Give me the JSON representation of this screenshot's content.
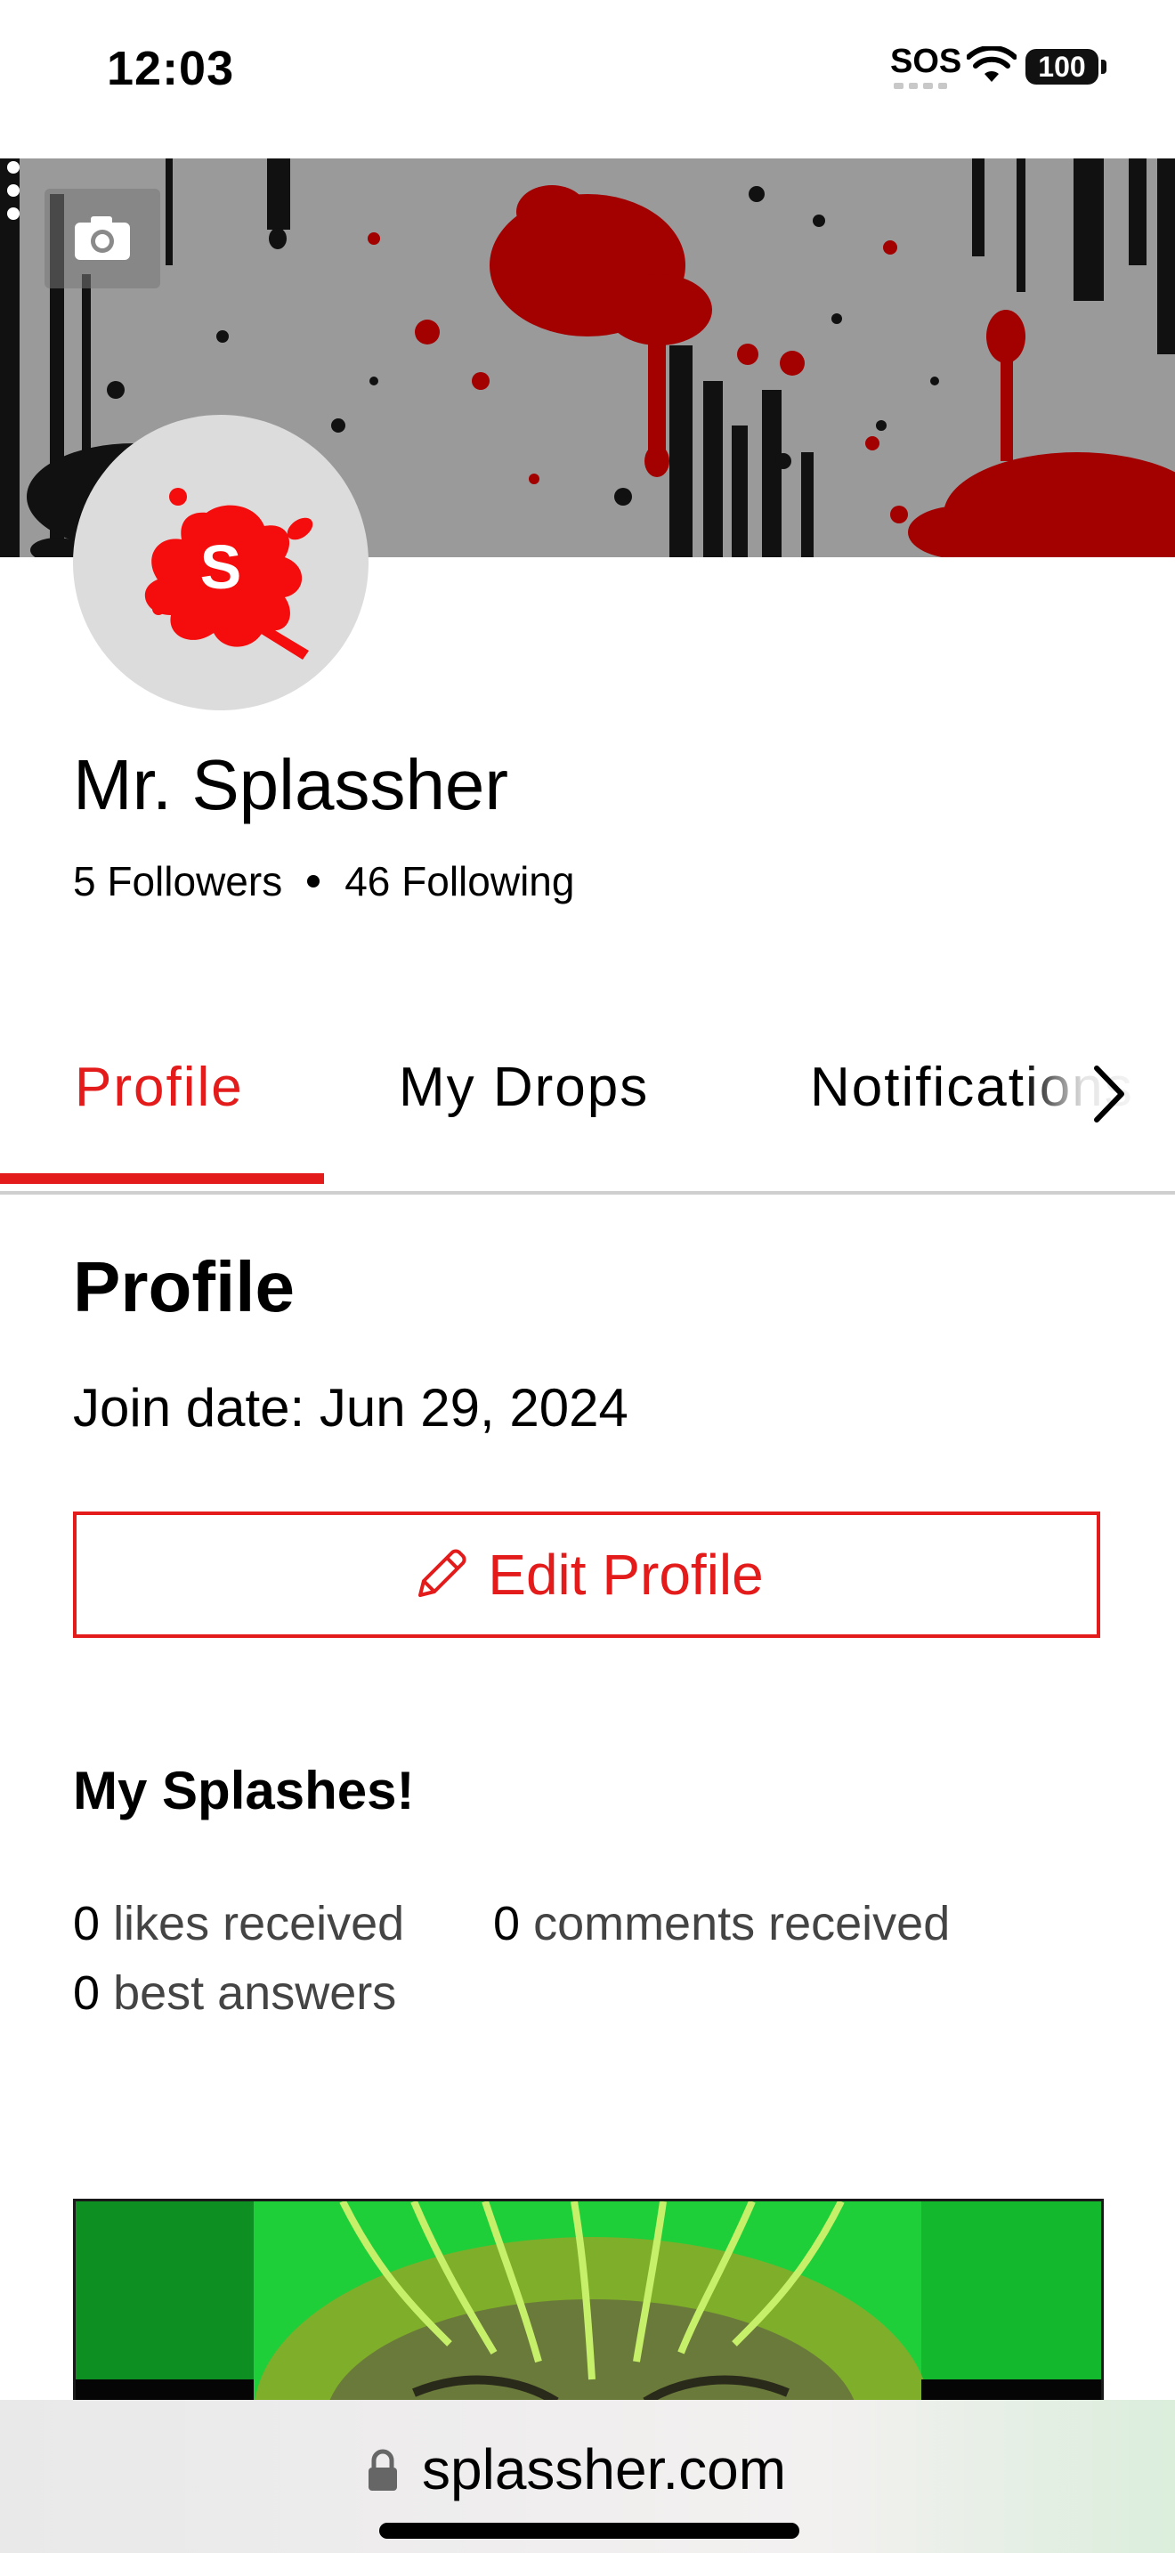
{
  "status_bar": {
    "time": "12:03",
    "sos": "SOS",
    "battery": "100"
  },
  "profile": {
    "name": "Mr. Splassher",
    "followers": "5 Followers",
    "following": "46 Following",
    "avatar_letter": "S"
  },
  "tabs": [
    {
      "label": "Profile",
      "active": true
    },
    {
      "label": "My Drops",
      "active": false
    },
    {
      "label": "Notifications",
      "active": false
    }
  ],
  "section": {
    "title": "Profile",
    "join_date": "Join date: Jun 29, 2024",
    "edit_button": "Edit Profile"
  },
  "splashes": {
    "title": "My Splashes!",
    "stats": [
      {
        "count": "0",
        "label": "likes received"
      },
      {
        "count": "0",
        "label": "comments received"
      },
      {
        "count": "0",
        "label": "best answers"
      }
    ]
  },
  "browser": {
    "url": "splassher.com"
  },
  "colors": {
    "accent": "#e31b1b",
    "banner_gray": "#9a9a9a",
    "splat_red": "#a30000"
  },
  "icons": [
    "camera-icon",
    "more-vertical-icon",
    "chevron-right-icon",
    "pencil-icon",
    "lock-icon",
    "wifi-icon"
  ]
}
